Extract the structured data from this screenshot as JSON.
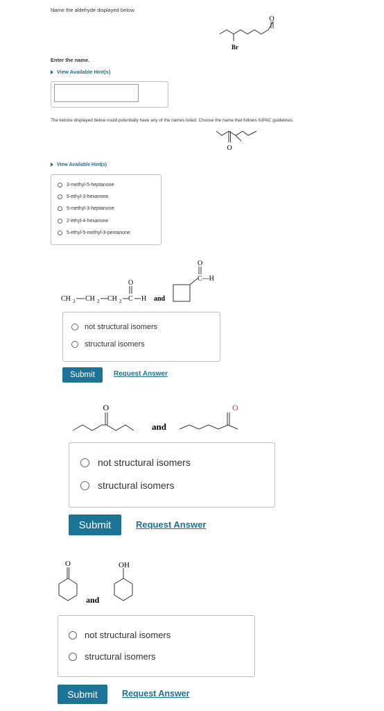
{
  "colors": {
    "accent": "#1b7396",
    "hint": "#1f6f8f",
    "border": "#bfbfbf"
  },
  "q1": {
    "prompt": "Name the aldehyde displayed below.",
    "structure_labels": {
      "oxygen": "O",
      "bromine": "Br"
    },
    "enter_label": "Enter the name.",
    "hint_label": "View Available Hint(s)",
    "answer_value": ""
  },
  "q2": {
    "prompt": "The ketone displayed below could potentially have any of the names listed. Choose the name that follows IUPAC guidelines.",
    "structure_labels": {
      "oxygen": "O"
    },
    "hint_label": "View Available Hint(s)",
    "options": [
      "3-methyl-5-heptanone",
      "5-ethyl-3-hexanone",
      "5-methyl-3-heptanone",
      "2-ethyl-4-hexanone",
      "5-ethyl-5-methyl-3-pentanone"
    ]
  },
  "q3": {
    "formula": {
      "ch3": "CH",
      "sub3": "3",
      "ch2a": "CH",
      "sub2a": "2",
      "ch2b": "CH",
      "sub2b": "2",
      "c": "C",
      "h": "H",
      "o": "O",
      "and": "and"
    },
    "ring_labels": {
      "o": "O",
      "ch": "C—H"
    },
    "options": [
      "not structural isomers",
      "structural isomers"
    ],
    "submit_label": "Submit",
    "request_label": "Request Answer"
  },
  "q4": {
    "labels": {
      "o_left": "O",
      "o_right": "O",
      "and": "and"
    },
    "options": [
      "not structural isomers",
      "structural isomers"
    ],
    "submit_label": "Submit",
    "request_label": "Request Answer"
  },
  "q5": {
    "labels": {
      "o": "O",
      "oh": "OH",
      "and": "and"
    },
    "options": [
      "not structural isomers",
      "structural isomers"
    ],
    "submit_label": "Submit",
    "request_label": "Request Answer"
  }
}
